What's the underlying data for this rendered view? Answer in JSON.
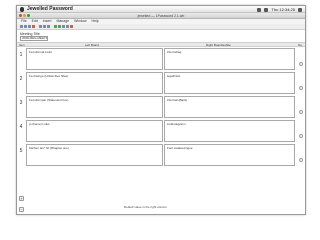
{
  "system_bar": {
    "app_name": "Jewelled Password",
    "status_text": "Thu 12:34:25"
  },
  "window": {
    "title": "jewelled — 1Password 2.1.wb"
  },
  "menu": [
    "File",
    "Edit",
    "Insert",
    "Manage",
    "Window",
    "Help"
  ],
  "meeting": {
    "label": "Meeting Title",
    "value": "2008-MEG-MEETINGNAME"
  },
  "table": {
    "headers": {
      "item": "Item",
      "left": "Left Board",
      "right": "Right Board/subtle",
      "no": "No"
    },
    "rows": [
      {
        "num": "1",
        "left": "Fa Informal Links",
        "right": "informdrag"
      },
      {
        "num": "2",
        "left": "Fa rhetrigo (Uzbek files hifes)",
        "right": "legethistic"
      },
      {
        "num": "3",
        "left": "Fa Informpar (Statement hve)",
        "right": "informal (Back)"
      },
      {
        "num": "4",
        "left": "(s theme) Links",
        "right": "Linkimages/m"
      },
      {
        "num": "5",
        "left": "Kitchen am* hit (Rhapsie one)",
        "right": "Font estates-lingue"
      }
    ]
  },
  "controls": {
    "add_label": "+",
    "remove_label": "−",
    "footer_hint": "Default value in the right column"
  }
}
